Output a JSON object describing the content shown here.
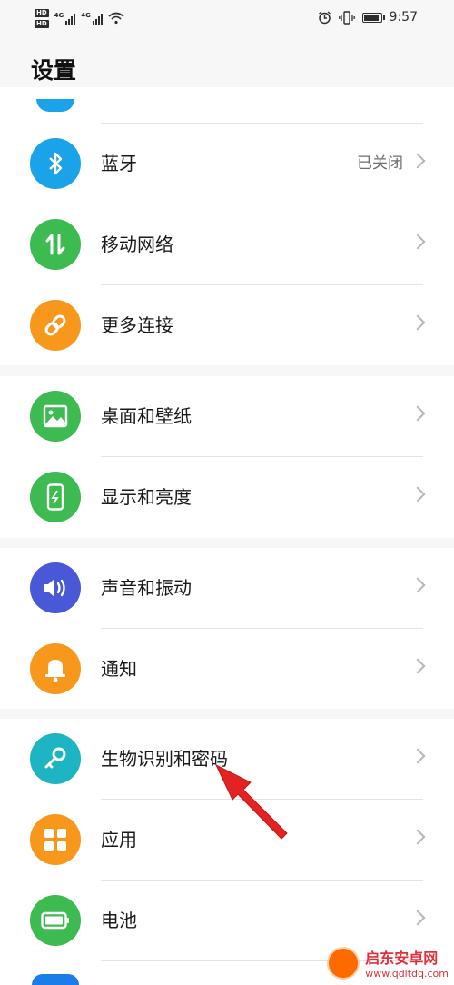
{
  "status_bar": {
    "hd1": "HD",
    "hd2": "HD",
    "net1": "4G",
    "net2": "4G",
    "time": "9:57",
    "icons": [
      "signal-icon",
      "wifi-icon",
      "alarm-icon",
      "vibrate-icon",
      "battery-icon"
    ]
  },
  "page": {
    "title": "设置"
  },
  "settings": [
    {
      "id": "bluetooth",
      "label": "蓝牙",
      "value": "已关闭",
      "icon": "bluetooth-icon",
      "color": "#1aa3e8"
    },
    {
      "id": "mobile-network",
      "label": "移动网络",
      "value": "",
      "icon": "mobile-data-icon",
      "color": "#3dbb50"
    },
    {
      "id": "more-connections",
      "label": "更多连接",
      "value": "",
      "icon": "link-icon",
      "color": "#f7981d"
    },
    {
      "id": "home-wallpaper",
      "label": "桌面和壁纸",
      "value": "",
      "icon": "image-icon",
      "color": "#3dbb50"
    },
    {
      "id": "display-brightness",
      "label": "显示和亮度",
      "value": "",
      "icon": "phone-display-icon",
      "color": "#3dbb50"
    },
    {
      "id": "sounds-vibration",
      "label": "声音和振动",
      "value": "",
      "icon": "speaker-icon",
      "color": "#4858d6"
    },
    {
      "id": "notifications",
      "label": "通知",
      "value": "",
      "icon": "bell-icon",
      "color": "#f7981d"
    },
    {
      "id": "biometrics-password",
      "label": "生物识别和密码",
      "value": "",
      "icon": "key-icon",
      "color": "#1db4c4"
    },
    {
      "id": "apps",
      "label": "应用",
      "value": "",
      "icon": "apps-grid-icon",
      "color": "#f7981d"
    },
    {
      "id": "battery",
      "label": "电池",
      "value": "",
      "icon": "battery-icon",
      "color": "#3dbb50"
    }
  ],
  "watermark": {
    "title": "启东安卓网",
    "url": "www.qdltdq.com"
  },
  "annotation": {
    "arrow_color": "#e32222"
  }
}
